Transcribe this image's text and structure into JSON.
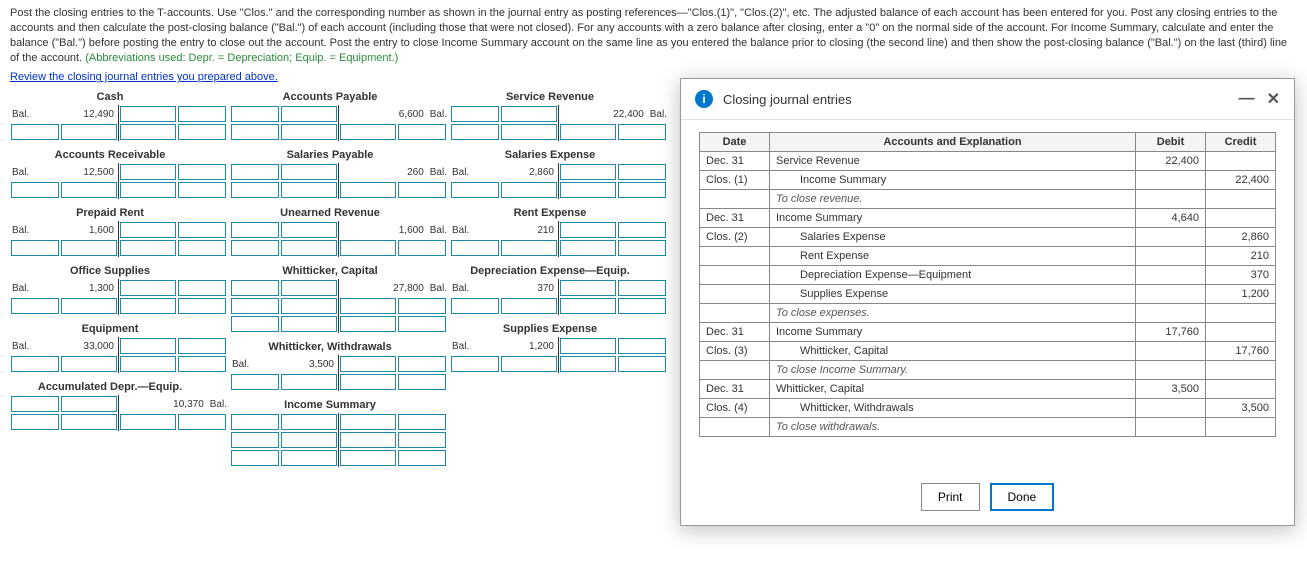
{
  "instructions": {
    "text": "Post the closing entries to the T-accounts. Use \"Clos.\" and the corresponding number as shown in the journal entry as posting references—\"Clos.(1)\", \"Clos.(2)\", etc. The adjusted balance of each account has been entered for you. Post any closing entries to the accounts and then calculate the post-closing balance (\"Bal.\") of each account (including those that were not closed). For any accounts with a zero balance after closing, enter a \"0\" on the normal side of the account. For Income Summary, calculate and enter the balance (\"Bal.\") before posting the entry to close out the account. Post the entry to close Income Summary account on the same line as you entered the balance prior to closing (the second line) and then show the post-closing balance (\"Bal.\") on the last (third) line of the account. ",
    "abbrev": "(Abbreviations used: Depr. = Depreciation; Equip. = Equipment.)"
  },
  "review_link": "Review the closing journal entries you prepared above.",
  "bal_label": "Bal.",
  "tacct_cols": [
    [
      {
        "title": "Cash",
        "debit_bal": "12,490",
        "credit_bal": "",
        "extra_rows": 1
      },
      {
        "title": "Accounts Receivable",
        "debit_bal": "12,500",
        "credit_bal": "",
        "extra_rows": 1
      },
      {
        "title": "Prepaid Rent",
        "debit_bal": "1,600",
        "credit_bal": "",
        "extra_rows": 1
      },
      {
        "title": "Office Supplies",
        "debit_bal": "1,300",
        "credit_bal": "",
        "extra_rows": 1
      },
      {
        "title": "Equipment",
        "debit_bal": "33,000",
        "credit_bal": "",
        "extra_rows": 1
      },
      {
        "title": "Accumulated Depr.—Equip.",
        "debit_bal": "",
        "credit_bal": "10,370 Bal.",
        "extra_rows": 1
      }
    ],
    [
      {
        "title": "Accounts Payable",
        "debit_bal": "",
        "credit_bal": "6,600 Bal.",
        "extra_rows": 1
      },
      {
        "title": "Salaries Payable",
        "debit_bal": "",
        "credit_bal": "260 Bal.",
        "extra_rows": 1
      },
      {
        "title": "Unearned Revenue",
        "debit_bal": "",
        "credit_bal": "1,600 Bal.",
        "extra_rows": 1
      },
      {
        "title": "Whitticker, Capital",
        "debit_bal": "",
        "credit_bal": "27,800 Bal.",
        "extra_rows": 2
      },
      {
        "title": "Whitticker, Withdrawals",
        "debit_bal": "3,500",
        "credit_bal": "",
        "bal_side": "debit",
        "extra_rows": 1,
        "debit_label": "Bal."
      },
      {
        "title": "Income Summary",
        "debit_bal": "",
        "credit_bal": "",
        "all_input": true,
        "extra_rows": 3
      }
    ],
    [
      {
        "title": "Service Revenue",
        "debit_bal": "",
        "credit_bal": "22,400 Bal.",
        "extra_rows": 1
      },
      {
        "title": "Salaries Expense",
        "debit_bal": "2,860",
        "credit_bal": "",
        "bal_side": "debit",
        "extra_rows": 1,
        "debit_label": "Bal."
      },
      {
        "title": "Rent Expense",
        "debit_bal": "210",
        "credit_bal": "",
        "bal_side": "debit",
        "extra_rows": 1,
        "debit_label": "Bal."
      },
      {
        "title": "Depreciation Expense—Equip.",
        "debit_bal": "370",
        "credit_bal": "",
        "bal_side": "debit",
        "extra_rows": 1,
        "debit_label": "Bal."
      },
      {
        "title": "Supplies Expense",
        "debit_bal": "1,200",
        "credit_bal": "",
        "bal_side": "debit",
        "extra_rows": 1,
        "debit_label": "Bal."
      }
    ]
  ],
  "modal": {
    "title": "Closing journal entries",
    "headers": {
      "date": "Date",
      "acct": "Accounts and Explanation",
      "debit": "Debit",
      "credit": "Credit"
    },
    "rows": [
      {
        "date": "Dec. 31",
        "acct": "Service Revenue",
        "debit": "22,400",
        "credit": ""
      },
      {
        "date": "Clos. (1)",
        "acct": "Income Summary",
        "indent": true,
        "debit": "",
        "credit": "22,400"
      },
      {
        "date": "",
        "acct": "To close revenue.",
        "explain": true
      },
      {
        "date": "Dec. 31",
        "acct": "Income Summary",
        "debit": "4,640",
        "credit": ""
      },
      {
        "date": "Clos. (2)",
        "acct": "Salaries Expense",
        "indent": true,
        "debit": "",
        "credit": "2,860"
      },
      {
        "date": "",
        "acct": "Rent Expense",
        "indent": true,
        "debit": "",
        "credit": "210"
      },
      {
        "date": "",
        "acct": "Depreciation Expense—Equipment",
        "indent": true,
        "debit": "",
        "credit": "370"
      },
      {
        "date": "",
        "acct": "Supplies Expense",
        "indent": true,
        "debit": "",
        "credit": "1,200"
      },
      {
        "date": "",
        "acct": "To close expenses.",
        "explain": true
      },
      {
        "date": "Dec. 31",
        "acct": "Income Summary",
        "debit": "17,760",
        "credit": ""
      },
      {
        "date": "Clos. (3)",
        "acct": "Whitticker, Capital",
        "indent": true,
        "debit": "",
        "credit": "17,760"
      },
      {
        "date": "",
        "acct": "To close Income Summary.",
        "explain": true
      },
      {
        "date": "Dec. 31",
        "acct": "Whitticker, Capital",
        "debit": "3,500",
        "credit": ""
      },
      {
        "date": "Clos. (4)",
        "acct": "Whitticker, Withdrawals",
        "indent": true,
        "debit": "",
        "credit": "3,500"
      },
      {
        "date": "",
        "acct": "To close withdrawals.",
        "explain": true
      }
    ],
    "print_label": "Print",
    "done_label": "Done"
  }
}
